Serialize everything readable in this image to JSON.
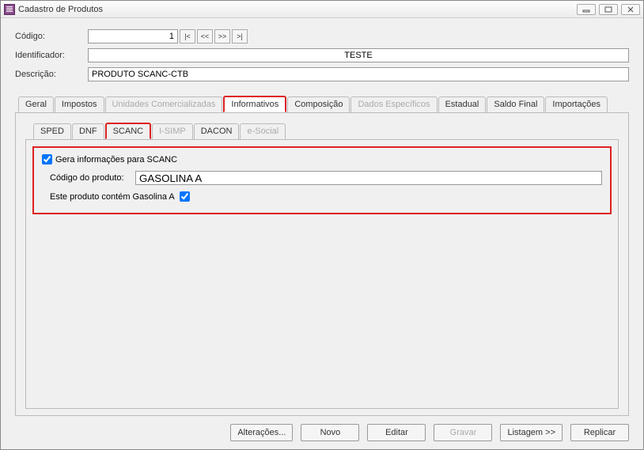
{
  "window": {
    "title": "Cadastro de Produtos"
  },
  "header": {
    "codigo_label": "Código:",
    "codigo_value": "1",
    "nav": {
      "first": "|<",
      "prev": "<<",
      "next": ">>",
      "last": ">|"
    },
    "identificador_label": "Identificador:",
    "identificador_value": "TESTE",
    "descricao_label": "Descrição:",
    "descricao_value": "PRODUTO SCANC-CTB"
  },
  "tabs_main": [
    {
      "label": "Geral",
      "disabled": false,
      "selected": false
    },
    {
      "label": "Impostos",
      "disabled": false,
      "selected": false
    },
    {
      "label": "Unidades Comercializadas",
      "disabled": true,
      "selected": false
    },
    {
      "label": "Informativos",
      "disabled": false,
      "selected": true
    },
    {
      "label": "Composição",
      "disabled": false,
      "selected": false
    },
    {
      "label": "Dados Específicos",
      "disabled": true,
      "selected": false
    },
    {
      "label": "Estadual",
      "disabled": false,
      "selected": false
    },
    {
      "label": "Saldo Final",
      "disabled": false,
      "selected": false
    },
    {
      "label": "Importações",
      "disabled": false,
      "selected": false
    }
  ],
  "tabs_sub": [
    {
      "label": "SPED",
      "disabled": false,
      "selected": false
    },
    {
      "label": "DNF",
      "disabled": false,
      "selected": false
    },
    {
      "label": "SCANC",
      "disabled": false,
      "selected": true
    },
    {
      "label": "I-SIMP",
      "disabled": true,
      "selected": false
    },
    {
      "label": "DACON",
      "disabled": false,
      "selected": false
    },
    {
      "label": "e-Social",
      "disabled": true,
      "selected": false
    }
  ],
  "scanc": {
    "gera_label": "Gera informações para SCANC",
    "gera_checked": true,
    "codigo_produto_label": "Código do produto:",
    "codigo_produto_value": "GASOLINA A",
    "contem_label": "Este produto contém Gasolina A",
    "contem_checked": true
  },
  "buttons": {
    "alteracoes": "Alterações...",
    "novo": "Novo",
    "editar": "Editar",
    "gravar": "Gravar",
    "listagem": "Listagem >>",
    "replicar": "Replicar"
  }
}
